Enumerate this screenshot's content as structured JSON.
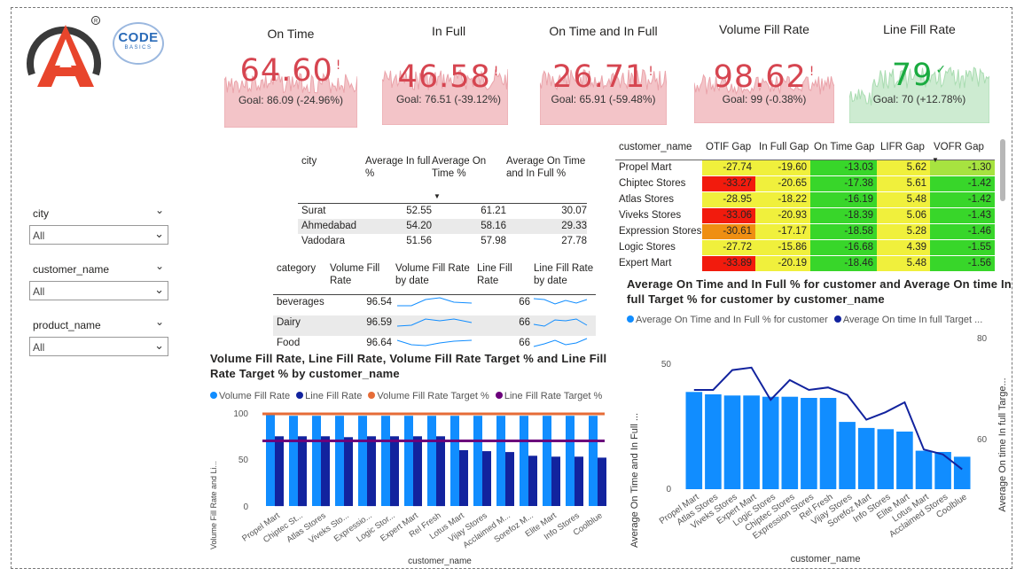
{
  "kpis": [
    {
      "title": "On Time",
      "value": "64.60",
      "mark": "!",
      "goal": "Goal: 86.09 (-24.96%)",
      "status": "bad"
    },
    {
      "title": "In Full",
      "value": "46.58",
      "mark": "!",
      "goal": "Goal: 76.51 (-39.12%)",
      "status": "bad"
    },
    {
      "title": "On Time and In Full",
      "value": "26.71",
      "mark": "!",
      "goal": "Goal: 65.91 (-59.48%)",
      "status": "bad"
    },
    {
      "title": "Volume Fill Rate",
      "value": "98.62",
      "mark": "!",
      "goal": "Goal: 99 (-0.38%)",
      "status": "bad"
    },
    {
      "title": "Line Fill Rate",
      "value": "79",
      "mark": "✓",
      "goal": "Goal: 70 (+12.78%)",
      "status": "good"
    }
  ],
  "logos": {
    "codebasics_line1": "CODE",
    "codebasics_line2": "BASICS"
  },
  "slicers": [
    {
      "title": "city",
      "value": "All"
    },
    {
      "title": "customer_name",
      "value": "All"
    },
    {
      "title": "product_name",
      "value": "All"
    }
  ],
  "city_table": {
    "headers": [
      "city",
      "Average In full %",
      "Average On Time %",
      "Average On Time and In Full %"
    ],
    "rows": [
      [
        "Surat",
        "52.55",
        "61.21",
        "30.07"
      ],
      [
        "Ahmedabad",
        "54.20",
        "58.16",
        "29.33"
      ],
      [
        "Vadodara",
        "51.56",
        "57.98",
        "27.78"
      ]
    ]
  },
  "category_table": {
    "headers": [
      "category",
      "Volume Fill Rate",
      "Volume Fill Rate by date",
      "Line Fill Rate",
      "Line Fill Rate by date"
    ],
    "rows": [
      [
        "beverages",
        "96.54",
        "66"
      ],
      [
        "Dairy",
        "96.59",
        "66"
      ],
      [
        "Food",
        "96.64",
        "66"
      ]
    ]
  },
  "gap_table": {
    "headers": [
      "customer_name",
      "OTIF Gap",
      "In Full Gap",
      "On Time Gap",
      "LIFR Gap",
      "VOFR Gap"
    ],
    "rows": [
      [
        "Propel Mart",
        "-27.74",
        "-19.60",
        "-13.03",
        "5.62",
        "-1.30"
      ],
      [
        "Chiptec Stores",
        "-33.27",
        "-20.65",
        "-17.38",
        "5.61",
        "-1.42"
      ],
      [
        "Atlas Stores",
        "-28.95",
        "-18.22",
        "-16.19",
        "5.48",
        "-1.42"
      ],
      [
        "Viveks Stores",
        "-33.06",
        "-20.93",
        "-18.39",
        "5.06",
        "-1.43"
      ],
      [
        "Expression Stores",
        "-30.61",
        "-17.17",
        "-18.58",
        "5.28",
        "-1.46"
      ],
      [
        "Logic Stores",
        "-27.72",
        "-15.86",
        "-16.68",
        "4.39",
        "-1.55"
      ],
      [
        "Expert Mart",
        "-33.89",
        "-20.19",
        "-18.46",
        "5.48",
        "-1.56"
      ]
    ],
    "colors": {
      "red": "#f21b0d",
      "orange": "#ef8f12",
      "yellow": "#f0f03c",
      "light_green": "#a7e340",
      "green": "#38d62a"
    }
  },
  "fill_chart": {
    "title": "Volume Fill Rate, Line Fill Rate, Volume Fill Rate Target % and Line Fill Rate Target % by customer_name",
    "legend": [
      "Volume Fill Rate",
      "Line Fill Rate",
      "Volume Fill Rate Target %",
      "Line Fill Rate Target %"
    ],
    "xlabel": "customer_name",
    "ylabel": "Volume Fill Rate and Li...",
    "tick_labels": [
      "0",
      "50",
      "100"
    ]
  },
  "otif_chart": {
    "title": "Average On Time and In Full % for customer and Average On time In full Target % for customer by customer_name",
    "legend": [
      "Average On Time and In Full % for customer",
      "Average On time In full Target ..."
    ],
    "xlabel": "customer_name",
    "ylabel_left": "Average On Time and In Full ...",
    "ylabel_right": "Average On time In full Targe...",
    "left_ticks": [
      "0",
      "50"
    ],
    "right_ticks": [
      "60",
      "80"
    ]
  },
  "chart_data": [
    {
      "type": "bar",
      "title": "Volume Fill Rate, Line Fill Rate, Volume Fill Rate Target % and Line Fill Rate Target % by customer_name",
      "xlabel": "customer_name",
      "ylabel": "Volume Fill Rate and Li...",
      "ylim": [
        0,
        100
      ],
      "categories": [
        "Propel Mart",
        "Chiptec St...",
        "Atlas Stores",
        "Viveks Sto...",
        "Expressio...",
        "Logic Stor...",
        "Expert Mart",
        "Rel Fresh",
        "Lotus Mart",
        "Vijay Stores",
        "Acclaimed M...",
        "Sorefoz M...",
        "Elite Mart",
        "Info Stores",
        "Coolblue"
      ],
      "series": [
        {
          "name": "Volume Fill Rate",
          "kind": "bar",
          "color": "#118dff",
          "values": [
            98,
            97,
            97,
            97,
            97,
            97,
            97,
            97,
            97,
            97,
            97,
            97,
            97,
            97,
            97
          ]
        },
        {
          "name": "Line Fill Rate",
          "kind": "bar",
          "color": "#12239e",
          "values": [
            75,
            75,
            75,
            74,
            75,
            75,
            75,
            75,
            60,
            59,
            58,
            54,
            53,
            53,
            52
          ]
        },
        {
          "name": "Volume Fill Rate Target %",
          "kind": "line",
          "color": "#e66c37",
          "values": [
            99,
            99,
            99,
            99,
            99,
            99,
            99,
            99,
            99,
            99,
            99,
            99,
            99,
            99,
            99
          ]
        },
        {
          "name": "Line Fill Rate Target %",
          "kind": "line",
          "color": "#6b007b",
          "values": [
            70,
            70,
            70,
            70,
            70,
            70,
            70,
            70,
            70,
            70,
            70,
            70,
            70,
            70,
            70
          ]
        }
      ],
      "legend_position": "top-left",
      "grid": false
    },
    {
      "type": "bar",
      "title": "Average On Time and In Full % for customer and Average On time In full Target % for customer by customer_name",
      "xlabel": "customer_name",
      "ylabel": "Average On Time and In Full ...",
      "ylim": [
        0,
        62
      ],
      "y2label": "Average On time In full Targe...",
      "y2lim": [
        50,
        80
      ],
      "categories": [
        "Propel Mart",
        "Atlas Stores",
        "Viveks Stores",
        "Expert Mart",
        "Logic Stores",
        "Chiptec Stores",
        "Expression Stores",
        "Rel Fresh",
        "Vijay Stores",
        "Sorefoz Mart",
        "Info Stores",
        "Elite Mart",
        "Lotus Mart",
        "Acclaimed Stores",
        "Coolblue"
      ],
      "series": [
        {
          "name": "Average On Time and In Full % for customer",
          "kind": "bar",
          "axis": "left",
          "color": "#118dff",
          "values": [
            40.5,
            39.5,
            39,
            39,
            38.5,
            38.5,
            38,
            38,
            28,
            25.5,
            25,
            24,
            16,
            15.5,
            13.5
          ]
        },
        {
          "name": "Average On time In full Target ...",
          "kind": "line",
          "axis": "right",
          "color": "#12239e",
          "values": [
            70,
            70,
            74,
            74.5,
            68,
            72,
            70,
            70.5,
            69,
            64,
            65.5,
            67.5,
            58,
            57,
            54
          ]
        }
      ],
      "legend_position": "top-left",
      "grid": false
    }
  ]
}
